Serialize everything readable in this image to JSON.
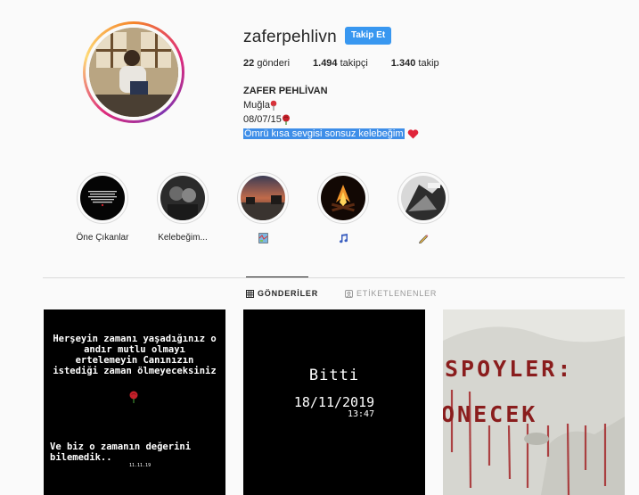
{
  "profile": {
    "username": "zaferpehlivn",
    "follow_label": "Takip Et",
    "stats": {
      "posts_count": "22",
      "posts_label": "gönderi",
      "followers_count": "1.494",
      "followers_label": "takipçi",
      "following_count": "1.340",
      "following_label": "takip"
    },
    "full_name": "ZAFER PEHLİVAN",
    "bio_lines": [
      "Muğla",
      "08/07/15",
      "Ömrü kısa sevgisi sonsuz kelebeğim"
    ]
  },
  "highlights": [
    {
      "label": "Öne Çıkanlar",
      "icon": "text-story-thumbnail"
    },
    {
      "label": "Kelebeğim...",
      "icon": "couple-photo-thumbnail"
    },
    {
      "label": "",
      "icon": "map-emoji",
      "cover": "sunset-road-thumbnail"
    },
    {
      "label": "",
      "icon": "music-note-emoji",
      "cover": "campfire-thumbnail"
    },
    {
      "label": "",
      "icon": "pencil-emoji",
      "cover": "monochrome-thumbnail"
    }
  ],
  "tabs": {
    "posts": "GÖNDERİLER",
    "tagged": "ETİKETLENENLER"
  },
  "posts": {
    "post1": {
      "text": "Herşeyin zamanı yaşadığınız o andır mutlu olmayı ertelemeyin Canınızın istediği zaman ölmeyeceksiniz",
      "bottom": "Ve biz o zamanın değerini bilemedik..",
      "date": "11.11.19"
    },
    "post2": {
      "title": "Bitti",
      "date": "18/11/2019",
      "time": "13:47"
    },
    "post3": {
      "line1": "SPOYLER:",
      "line2": "ONECEK"
    }
  },
  "colors": {
    "follow_button": "#3897f0",
    "selection": "#3e8ee8",
    "graffiti": "#8a1d1d"
  }
}
